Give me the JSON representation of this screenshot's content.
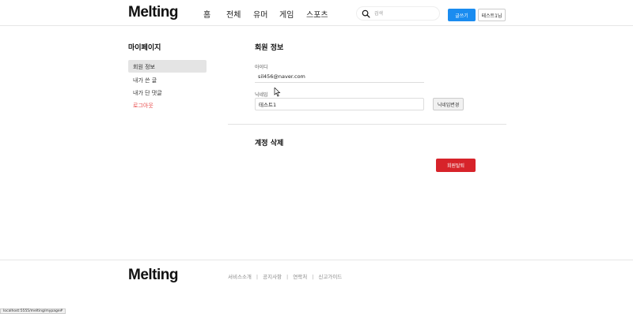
{
  "header": {
    "logo": "Melting",
    "nav": [
      "홈",
      "전체",
      "유머",
      "게임",
      "스포츠"
    ],
    "search_placeholder": "검색",
    "write_label": "글쓰기",
    "user_label": "테스트1님"
  },
  "sidebar": {
    "title": "마이페이지",
    "items": [
      {
        "label": "회원 정보"
      },
      {
        "label": "내가 쓴 글"
      },
      {
        "label": "내가 단 댓글"
      },
      {
        "label": "로그아웃"
      }
    ]
  },
  "member_info": {
    "title": "회원 정보",
    "id_label": "아이디",
    "id_value": "sil456@naver.com",
    "nickname_label": "닉네임",
    "nickname_value": "테스트1",
    "nickname_change_label": "닉네임변경"
  },
  "account_delete": {
    "title": "계정 삭제",
    "withdraw_label": "회원탈퇴"
  },
  "footer": {
    "logo": "Melting",
    "links": [
      "서비스소개",
      "공지사항",
      "연락처",
      "신고가이드"
    ]
  },
  "status_url": "localhost:5555/melting/mypage#",
  "colors": {
    "primary": "#1a8cf0",
    "danger": "#d7232a",
    "logout": "#e84a4a"
  }
}
